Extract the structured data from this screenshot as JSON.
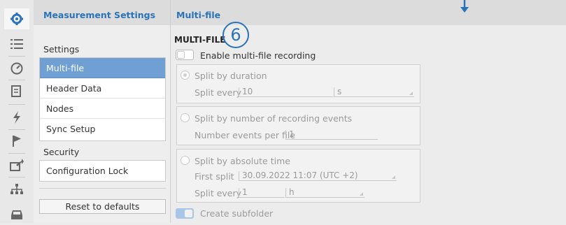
{
  "sidebar": {
    "title": "Measurement Settings",
    "settings_heading": "Settings",
    "items": [
      {
        "label": "Multi-file",
        "active": true
      },
      {
        "label": "Header Data",
        "active": false
      },
      {
        "label": "Nodes",
        "active": false
      },
      {
        "label": "Sync Setup",
        "active": false
      }
    ],
    "security_heading": "Security",
    "security_items": [
      {
        "label": "Configuration Lock"
      }
    ],
    "reset_label": "Reset to defaults"
  },
  "iconbar": {
    "icons": [
      "gear-icon",
      "list-icon",
      "gauge-icon",
      "document-icon",
      "lightning-icon",
      "flag-icon",
      "export-icon",
      "network-icon",
      "vehicle-icon"
    ]
  },
  "main": {
    "header_title": "Multi-file",
    "section_title": "MULTI-FILE",
    "badge": "6",
    "enable_label": "Enable multi-file recording",
    "duration": {
      "option_label": "Split by duration",
      "split_every_label": "Split every",
      "split_every_value": "10",
      "unit": "s"
    },
    "events": {
      "option_label": "Split by number of recording events",
      "events_label": "Number events per file",
      "events_value": "1"
    },
    "absolute": {
      "option_label": "Split by absolute time",
      "first_split_label": "First split",
      "first_split_value": "30.09.2022 11:07 (UTC +2)",
      "split_every_label": "Split every",
      "split_every_value": "1",
      "unit": "h"
    },
    "subfolder_label": "Create subfolder"
  },
  "colors": {
    "accent": "#2a73b8",
    "active_nav": "#6f9fd3"
  }
}
